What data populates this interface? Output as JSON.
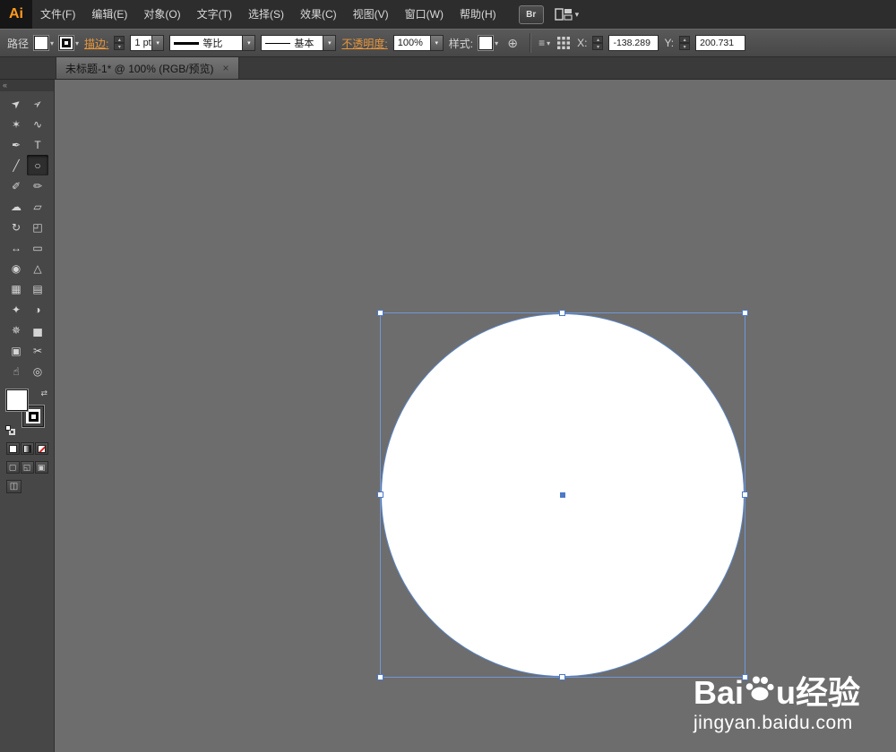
{
  "menubar": {
    "logo": "Ai",
    "items": [
      "文件(F)",
      "编辑(E)",
      "对象(O)",
      "文字(T)",
      "选择(S)",
      "效果(C)",
      "视图(V)",
      "窗口(W)",
      "帮助(H)"
    ],
    "bridge_label": "Br"
  },
  "controlbar": {
    "selection_type": "路径",
    "stroke_label": "描边:",
    "stroke_width": "1 pt",
    "width_profile": "等比",
    "brush_definition": "基本",
    "opacity_label": "不透明度:",
    "opacity_value": "100%",
    "style_label": "样式:",
    "x_label": "X:",
    "x_value": "-138.289",
    "y_label": "Y:",
    "y_value": "200.731"
  },
  "document_tab": {
    "title": "未标题-1* @ 100% (RGB/预览)",
    "close_icon": "×"
  },
  "toolbar": {
    "collapse_icon": "«",
    "tools": [
      {
        "name": "selection",
        "glyph": "➤",
        "rot": true
      },
      {
        "name": "direct-selection",
        "glyph": "➢",
        "rot": true
      },
      {
        "name": "magic-wand",
        "glyph": "✶"
      },
      {
        "name": "lasso",
        "glyph": "∿"
      },
      {
        "name": "pen",
        "glyph": "✒"
      },
      {
        "name": "type",
        "glyph": "T"
      },
      {
        "name": "line-segment",
        "glyph": "╱"
      },
      {
        "name": "ellipse",
        "glyph": "○",
        "selected": true
      },
      {
        "name": "paintbrush",
        "glyph": "✐"
      },
      {
        "name": "pencil",
        "glyph": "✏"
      },
      {
        "name": "blob-brush",
        "glyph": "☁"
      },
      {
        "name": "eraser",
        "glyph": "▱"
      },
      {
        "name": "rotate",
        "glyph": "↻"
      },
      {
        "name": "scale",
        "glyph": "◰"
      },
      {
        "name": "width",
        "glyph": "↔"
      },
      {
        "name": "free-transform",
        "glyph": "▭"
      },
      {
        "name": "shape-builder",
        "glyph": "◉"
      },
      {
        "name": "perspective-grid",
        "glyph": "△"
      },
      {
        "name": "mesh",
        "glyph": "▦"
      },
      {
        "name": "gradient",
        "glyph": "▤"
      },
      {
        "name": "eyedropper",
        "glyph": "✦"
      },
      {
        "name": "blend",
        "glyph": "◑"
      },
      {
        "name": "symbol-sprayer",
        "glyph": "✵"
      },
      {
        "name": "column-graph",
        "glyph": "▅"
      },
      {
        "name": "artboard",
        "glyph": "▣"
      },
      {
        "name": "slice",
        "glyph": "✂"
      },
      {
        "name": "hand",
        "glyph": "☝"
      },
      {
        "name": "zoom",
        "glyph": "◎"
      }
    ],
    "draw_mode_icons": [
      "▢",
      "◱",
      "▣"
    ],
    "screen_mode_icon": "◫"
  },
  "icons": {
    "dropdown": "▾",
    "stepper_up": "▴",
    "stepper_down": "▾",
    "globe": "⊕",
    "align": "≡",
    "swap": "⇄"
  },
  "canvas": {
    "shape": "ellipse",
    "fill": "#ffffff"
  },
  "watermark": {
    "brand_parts": [
      "Bai",
      "u",
      "经验"
    ],
    "url": "jingyan.baidu.com"
  },
  "colors": {
    "selection_blue": "#4d79c6",
    "canvas_gray": "#6d6d6d",
    "accent_orange": "#e8963c",
    "logo_orange": "#ff9b1e"
  }
}
